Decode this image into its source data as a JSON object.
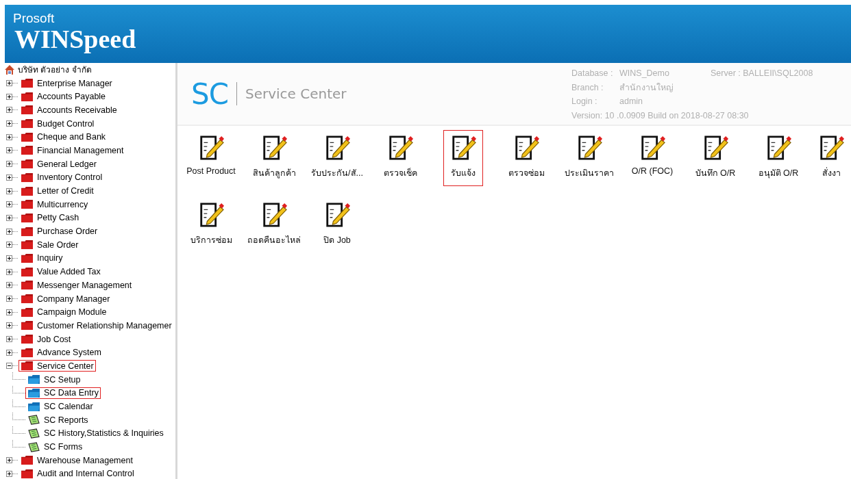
{
  "header": {
    "brand_top": "Prosoft",
    "brand_main": "WINSpeed"
  },
  "tree": {
    "root": "บริษัท ตัวอย่าง จำกัด",
    "items": [
      {
        "label": "Enterprise Manager",
        "expanded": false,
        "highlighted": false
      },
      {
        "label": "Accounts Payable",
        "expanded": false,
        "highlighted": false
      },
      {
        "label": "Accounts Receivable",
        "expanded": false,
        "highlighted": false
      },
      {
        "label": "Budget Control",
        "expanded": false,
        "highlighted": false
      },
      {
        "label": "Cheque and Bank",
        "expanded": false,
        "highlighted": false
      },
      {
        "label": "Financial Management",
        "expanded": false,
        "highlighted": false
      },
      {
        "label": "General Ledger",
        "expanded": false,
        "highlighted": false
      },
      {
        "label": "Inventory Control",
        "expanded": false,
        "highlighted": false
      },
      {
        "label": "Letter of Credit",
        "expanded": false,
        "highlighted": false
      },
      {
        "label": "Multicurrency",
        "expanded": false,
        "highlighted": false
      },
      {
        "label": "Petty Cash",
        "expanded": false,
        "highlighted": false
      },
      {
        "label": "Purchase Order",
        "expanded": false,
        "highlighted": false
      },
      {
        "label": "Sale Order",
        "expanded": false,
        "highlighted": false
      },
      {
        "label": "Inquiry",
        "expanded": false,
        "highlighted": false
      },
      {
        "label": "Value Added Tax",
        "expanded": false,
        "highlighted": false
      },
      {
        "label": "Messenger Management",
        "expanded": false,
        "highlighted": false
      },
      {
        "label": "Company Manager",
        "expanded": false,
        "highlighted": false
      },
      {
        "label": "Campaign Module",
        "expanded": false,
        "highlighted": false
      },
      {
        "label": "Customer Relationship Managemer",
        "expanded": false,
        "highlighted": false
      },
      {
        "label": "Job Cost",
        "expanded": false,
        "highlighted": false
      },
      {
        "label": "Advance System",
        "expanded": false,
        "highlighted": false
      },
      {
        "label": "Service Center",
        "expanded": true,
        "highlighted": true,
        "children": [
          {
            "label": "SC Setup",
            "kind": "folder",
            "highlighted": false
          },
          {
            "label": "SC Data Entry",
            "kind": "folder",
            "highlighted": true
          },
          {
            "label": "SC Calendar",
            "kind": "folder",
            "highlighted": false
          },
          {
            "label": "SC Reports",
            "kind": "report",
            "highlighted": false
          },
          {
            "label": "SC History,Statistics & Inquiries",
            "kind": "report",
            "highlighted": false
          },
          {
            "label": "SC Forms",
            "kind": "report",
            "highlighted": false
          }
        ]
      },
      {
        "label": "Warehouse Management",
        "expanded": false,
        "highlighted": false
      },
      {
        "label": "Audit and Internal Control",
        "expanded": false,
        "highlighted": false
      }
    ]
  },
  "module": {
    "code": "SC",
    "title": "Service Center"
  },
  "info": {
    "database_label": "Database :",
    "database": "WINS_Demo",
    "server": "Server : BALLEII\\SQL2008",
    "branch_label": "Branch :",
    "branch": "สำนักงานใหญ่",
    "login_label": "Login :",
    "login": "admin",
    "version": "Version: 10 .0.0909  Build on 2018-08-27 08:30"
  },
  "programs": [
    {
      "label": "Post Product",
      "highlighted": false
    },
    {
      "label": "สินค้าลูกค้า",
      "highlighted": false
    },
    {
      "label": "รับประกัน/สั...",
      "highlighted": false
    },
    {
      "label": "ตรวจเช็ค",
      "highlighted": false
    },
    {
      "label": "รับแจ้ง",
      "highlighted": true
    },
    {
      "label": "ตรวจซ่อม",
      "highlighted": false
    },
    {
      "label": "ประเมินราคา",
      "highlighted": false
    },
    {
      "label": "O/R (FOC)",
      "highlighted": false
    },
    {
      "label": "บันทึก O/R",
      "highlighted": false
    },
    {
      "label": "อนุมัติ O/R",
      "highlighted": false
    },
    {
      "label": "สั่งงา",
      "highlighted": false
    },
    {
      "label": "บริการซ่อม",
      "highlighted": false
    },
    {
      "label": "ถอดคืนอะไหล่",
      "highlighted": false
    },
    {
      "label": "ปิด Job",
      "highlighted": false
    }
  ]
}
